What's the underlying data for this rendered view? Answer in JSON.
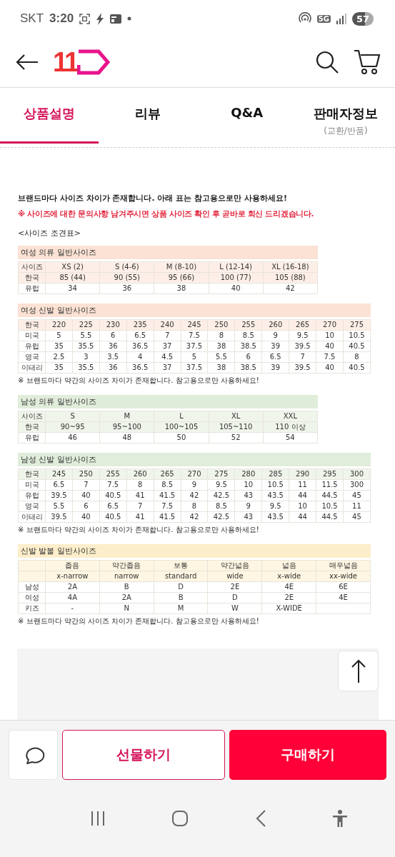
{
  "status_bar": {
    "carrier": "SKT",
    "time": "3:20",
    "network": "5G",
    "battery": "57"
  },
  "header": {
    "logo": "11"
  },
  "tabs": [
    {
      "label": "상품설명",
      "selected": true
    },
    {
      "label": "리뷰",
      "selected": false
    },
    {
      "label": "Q&A",
      "selected": false
    },
    {
      "label": "판매자정보",
      "sub": "(교환/반품)",
      "selected": false
    }
  ],
  "intro": {
    "line1": "브랜드마다 사이즈 차이가 존재합니다. 아래 표는 **참고용**으로만 사용하세요!",
    "line2": "※ 사이즈에 대한 문의사항 남겨주시면 상품 사이즈 확인 후 곧바로 회신 드리겠습니다.",
    "heading": "<사이즈 조견표>"
  },
  "size_tables": [
    {
      "title": "여성 의류 일반사이즈",
      "kind": "clothing",
      "color": "#fbe2d4",
      "rows": [
        {
          "header": true,
          "cells": [
            "사이즈",
            "XS (2)",
            "S (4-6)",
            "M (8-10)",
            "L (12-14)",
            "XL (16-18)"
          ]
        },
        {
          "header": true,
          "cells": [
            "한국",
            "85 (44)",
            "90 (55)",
            "95 (66)",
            "100 (77)",
            "105 (88)"
          ]
        },
        {
          "header": false,
          "cells": [
            "유럽",
            "34",
            "36",
            "38",
            "40",
            "42"
          ]
        }
      ]
    },
    {
      "title": "여성 신발 일반사이즈",
      "kind": "shoes",
      "color": "#fbe2d4",
      "note": "※ 브랜드마다 약간의 사이즈 차이가 존재합니다. 참고용으로만 사용하세요!",
      "rows": [
        {
          "header": true,
          "cells": [
            "한국",
            "220",
            "225",
            "230",
            "235",
            "240",
            "245",
            "250",
            "255",
            "260",
            "265",
            "270",
            "275"
          ]
        },
        {
          "header": false,
          "cells": [
            "미국",
            "5",
            "5.5",
            "6",
            "6.5",
            "7",
            "7.5",
            "8",
            "8.5",
            "9",
            "9.5",
            "10",
            "10.5"
          ]
        },
        {
          "header": false,
          "cells": [
            "유럽",
            "35",
            "35.5",
            "36",
            "36.5",
            "37",
            "37.5",
            "38",
            "38.5",
            "39",
            "39.5",
            "40",
            "40.5"
          ]
        },
        {
          "header": false,
          "cells": [
            "영국",
            "2.5",
            "3",
            "3.5",
            "4",
            "4.5",
            "5",
            "5.5",
            "6",
            "6.5",
            "7",
            "7.5",
            "8"
          ]
        },
        {
          "header": false,
          "cells": [
            "이태리",
            "35",
            "35.5",
            "36",
            "36.5",
            "37",
            "37.5",
            "38",
            "38.5",
            "39",
            "39.5",
            "40",
            "40.5"
          ]
        }
      ]
    },
    {
      "title": "남성 의류 일반사이즈",
      "kind": "clothing",
      "color": "#e1eddb",
      "rows": [
        {
          "header": true,
          "cells": [
            "사이즈",
            "S",
            "M",
            "L",
            "XL",
            "XXL"
          ]
        },
        {
          "header": true,
          "cells": [
            "한국",
            "90~95",
            "95~100",
            "100~105",
            "105~110",
            "110 이상"
          ]
        },
        {
          "header": false,
          "cells": [
            "유럽",
            "46",
            "48",
            "50",
            "52",
            "54"
          ]
        }
      ]
    },
    {
      "title": "남성 신발 일반사이즈",
      "kind": "shoes",
      "color": "#e1eddb",
      "note": "※ 브랜드마다 약간의 사이즈 차이가 존재합니다. 참고용으로만 사용하세요!",
      "rows": [
        {
          "header": true,
          "cells": [
            "한국",
            "245",
            "250",
            "255",
            "260",
            "265",
            "270",
            "275",
            "280",
            "285",
            "290",
            "295",
            "300"
          ]
        },
        {
          "header": false,
          "cells": [
            "미국",
            "6.5",
            "7",
            "7.5",
            "8",
            "8.5",
            "9",
            "9.5",
            "10",
            "10.5",
            "11",
            "11.5",
            "300"
          ]
        },
        {
          "header": false,
          "cells": [
            "유럽",
            "39.5",
            "40",
            "40.5",
            "41",
            "41.5",
            "42",
            "42.5",
            "43",
            "43.5",
            "44",
            "44.5",
            "45"
          ]
        },
        {
          "header": false,
          "cells": [
            "영국",
            "5.5",
            "6",
            "6.5",
            "7",
            "7.5",
            "8",
            "8.5",
            "9",
            "9.5",
            "10",
            "10.5",
            "11"
          ]
        },
        {
          "header": false,
          "cells": [
            "이태리",
            "39.5",
            "40",
            "40.5",
            "41",
            "41.5",
            "42",
            "42.5",
            "43",
            "43.5",
            "44",
            "44.5",
            "45"
          ]
        }
      ]
    },
    {
      "title": "신발 발볼 일반사이즈",
      "kind": "shoes",
      "color": "#fdeecb",
      "note": "※ 브랜드마다 약간의 사이즈 차이가 존재합니다. 참고용으로만 사용하세요!",
      "rows": [
        {
          "header": true,
          "cells": [
            null,
            "좁음",
            "약간좁음",
            "보통",
            "약간넓음",
            "넓음",
            "매우넓음"
          ]
        },
        {
          "header": true,
          "cells": [
            null,
            "x-narrow",
            "narrow",
            "standard",
            "wide",
            "x-wide",
            "xx-wide"
          ]
        },
        {
          "header": false,
          "cells": [
            "남성",
            "2A",
            "B",
            "D",
            "2E",
            "4E",
            "6E"
          ]
        },
        {
          "header": false,
          "cells": [
            "여성",
            "4A",
            "2A",
            "B",
            "D",
            "2E",
            "4E"
          ]
        },
        {
          "header": false,
          "cells": [
            "키즈",
            "-",
            "N",
            "M",
            "W",
            "X-WIDE",
            null
          ]
        }
      ]
    }
  ],
  "bottom_bar": {
    "gift": "선물하기",
    "buy": "구매하기"
  }
}
